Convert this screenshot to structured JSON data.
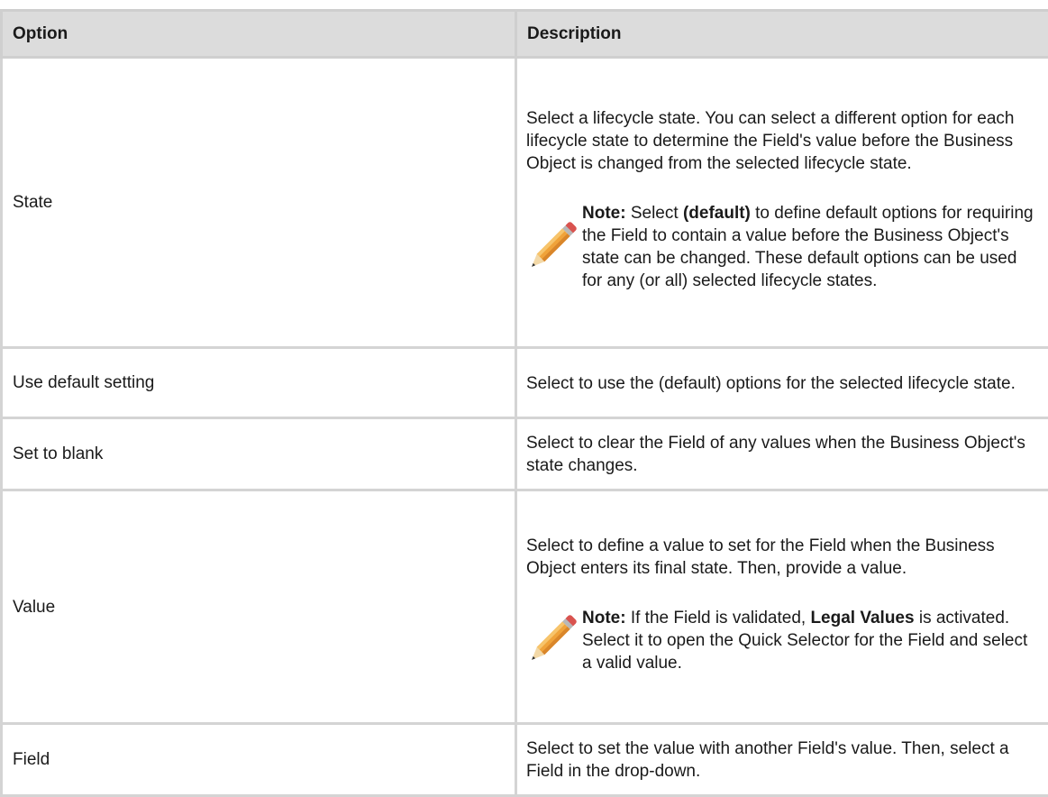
{
  "table": {
    "headers": {
      "option": "Option",
      "description": "Description"
    },
    "rows": [
      {
        "option": "State",
        "description": "Select a lifecycle state. You can select a different option for each lifecycle state to determine the Field's value before the Business Object is changed from the selected lifecycle state.",
        "note": {
          "label": "Note:",
          "t1": " Select ",
          "bold": "(default)",
          "t2": " to define default options for requiring the Field to contain a value before the Business Object's state can be changed. These default options can be used for any (or all) selected lifecycle states."
        }
      },
      {
        "option": "Use default setting",
        "description": "Select to use the (default) options for the selected lifecycle state."
      },
      {
        "option": "Set to blank",
        "description": "Select to clear the Field of any values when the Business Object's state changes."
      },
      {
        "option": "Value",
        "description": "Select to define a value to set for the Field when the Business Object enters its final state. Then, provide a value.",
        "note": {
          "label": "Note:",
          "t1": " If the Field is validated, ",
          "bold": "Legal Values",
          "t2": " is activated. Select it to open the Quick Selector for the Field and select a valid value."
        }
      },
      {
        "option": "Field",
        "description": "Select to set the value with another Field's value. Then, select a Field in the drop-down."
      }
    ]
  },
  "icons": {
    "note_icon": "pencil-icon"
  }
}
